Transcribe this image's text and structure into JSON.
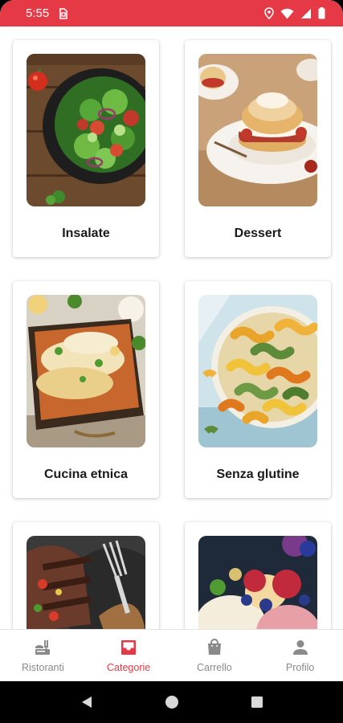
{
  "status_bar": {
    "time": "5:55",
    "background": "#e63946",
    "icons": [
      "sim-icon",
      "location-icon",
      "wifi-icon",
      "signal-icon",
      "battery-icon"
    ]
  },
  "categories": [
    {
      "label": "Insalate",
      "image": "salad-image"
    },
    {
      "label": "Dessert",
      "image": "dessert-image"
    },
    {
      "label": "Cucina etnica",
      "image": "enchilada-image"
    },
    {
      "label": "Senza glutine",
      "image": "fusilli-pasta-image"
    },
    {
      "label": "",
      "image": "grilled-steak-image"
    },
    {
      "label": "",
      "image": "ice-cream-berries-image"
    }
  ],
  "bottom_nav": {
    "active_color": "#e63946",
    "items": [
      {
        "label": "Ristoranti",
        "icon": "restaurant-icon",
        "active": false
      },
      {
        "label": "Categorie",
        "icon": "inbox-icon",
        "active": true
      },
      {
        "label": "Carrello",
        "icon": "shopping-bag-icon",
        "active": false
      },
      {
        "label": "Profilo",
        "icon": "person-icon",
        "active": false
      }
    ]
  },
  "system_nav": [
    "back-icon",
    "home-icon",
    "recents-icon"
  ]
}
